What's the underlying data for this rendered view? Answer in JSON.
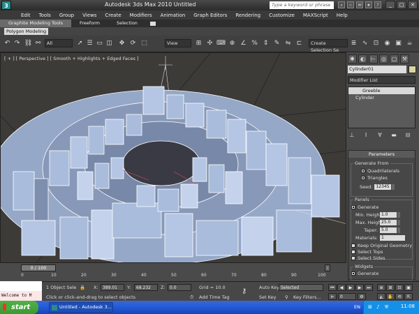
{
  "window": {
    "title": "Autodesk 3ds Max  2010      Untitled",
    "search_placeholder": "Type a keyword or phrase",
    "logo": "3"
  },
  "menu": [
    "Edit",
    "Tools",
    "Group",
    "Views",
    "Create",
    "Modifiers",
    "Animation",
    "Graph Editors",
    "Rendering",
    "Customize",
    "MAXScript",
    "Help"
  ],
  "ribbon": {
    "tabs": [
      "Graphite Modeling Tools",
      "Freeform",
      "Selection"
    ],
    "sub_label": "Polygon Modeling"
  },
  "toolbar": {
    "filter": "All",
    "ref_coord": "View",
    "named_selection": "Create Selection Se"
  },
  "viewport": {
    "label": "[ + ] [ Perspective ] [ Smooth + Highlights + Edged Faces ]"
  },
  "command_panel": {
    "object_name": "Cylinder01",
    "modifier_list": "Modifier List",
    "stack": [
      "Greeble",
      "Cylinder"
    ],
    "selected_index": 0,
    "rollout_title": "Parameters",
    "generate_from": {
      "title": "Generate From",
      "quadrilaterals": "Quadrilaterals",
      "triangles": "Triangles",
      "seed_label": "Seed:",
      "seed_value": "12345"
    },
    "panels": {
      "title": "Panels",
      "generate": "Generate",
      "min_height_label": "Min. Height:",
      "min_height": "1.0",
      "max_height_label": "Max. Height:",
      "max_height": "25.0",
      "taper_label": "Taper:",
      "taper": "5.0",
      "materials_label": "Materials:",
      "materials": "1",
      "keep_geometry": "Keep Original Geometry",
      "select_tops": "Select Tops",
      "select_sides": "Select Sides"
    },
    "widgets": {
      "title": "Widgets",
      "generate": "Generate"
    }
  },
  "timeline": {
    "slider": "0 / 100",
    "ticks": [
      "0",
      "10",
      "20",
      "30",
      "40",
      "50",
      "60",
      "70",
      "80",
      "90",
      "100"
    ]
  },
  "status": {
    "maxscript_text": "Welcome to M",
    "selection_count": "1 Object Sele",
    "x_label": "X:",
    "x": "389.01",
    "y_label": "Y:",
    "y": "68.232",
    "z_label": "Z:",
    "z": "0.0",
    "grid": "Grid = 10.0",
    "prompt": "Click or click-and-drag to select objects",
    "add_time_tag": "Add Time Tag",
    "auto_key": "Auto Key",
    "set_key": "Set Key",
    "key_mode": "Selected",
    "key_filters": "Key Filters...",
    "frame": "0"
  },
  "taskbar": {
    "start": "start",
    "task": "Untitled - Autodesk 3...",
    "lang": "EN",
    "clock": "11:08"
  }
}
